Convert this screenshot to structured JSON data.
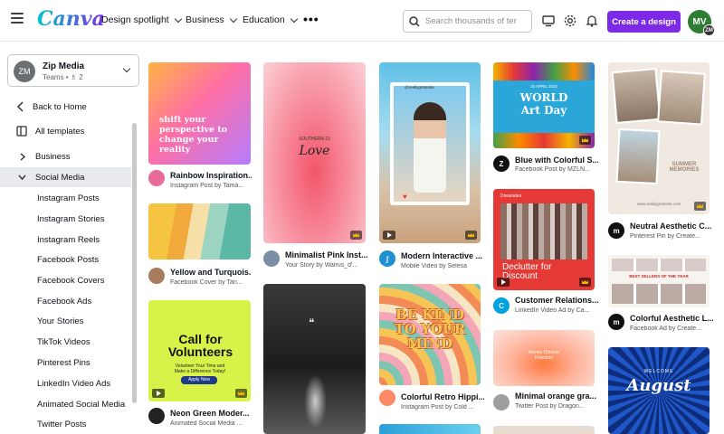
{
  "header": {
    "logo": "Canva",
    "nav": [
      "Design spotlight",
      "Business",
      "Education"
    ],
    "more": "•••",
    "search_placeholder": "Search thousands of ter",
    "create_label": "Create a design",
    "avatar_initials": "MV",
    "avatar_badge": "ZM"
  },
  "team": {
    "initials": "ZM",
    "name": "Zip Media",
    "sub": "Teams • ♗ 2"
  },
  "sidebar": {
    "back": "Back to Home",
    "all": "All templates",
    "business": "Business",
    "social": "Social Media",
    "items": [
      "Instagram Posts",
      "Instagram Stories",
      "Instagram Reels",
      "Facebook Posts",
      "Facebook Covers",
      "Facebook Ads",
      "Your Stories",
      "TikTok Videos",
      "Pinterest Pins",
      "LinkedIn Video Ads",
      "Animated Social Media",
      "Twitter Posts"
    ]
  },
  "cards": {
    "c1": {
      "title": "Rainbow Inspiration...",
      "sub": "Instagram Post by Tama...",
      "text": "shift your perspective to change your reality"
    },
    "c2": {
      "title": "Yellow and Turquois...",
      "sub": "Facebook Cover by Tan..."
    },
    "c3": {
      "title": "Neon Green Moder...",
      "sub": "Animated Social Media ...",
      "text": "Call for Volunteers",
      "small": "Volunteer Your Time and Make a Difference Today!",
      "btn": "Apply Now"
    },
    "c4": {
      "title": "Minimalist Pink Inst...",
      "sub": "Your Story by Walrus_d'...",
      "text": "Love",
      "small": "SOUTHERN 22"
    },
    "c5": {
      "title": "Modern Interactive ...",
      "sub": "Mobile Video by Selesa",
      "handle": "@reallygreatsite"
    },
    "c6": {
      "title": "Blue with Colorful S...",
      "sub": "Facebook Post by MZLN...",
      "text": "WORLD Art Day",
      "date": "15 APRIL 2022"
    },
    "c7": {
      "title": "Declutter for Discount",
      "card_title": "Declutter for Discount",
      "sub": "LinkedIn Video Ad by Ca...",
      "title2": "Customer Relations...",
      "brand": "Dreamden"
    },
    "c8": {
      "title": "Colorful Retro Hippi...",
      "sub": "Instagram Post by Cold ...",
      "text": "BE KIND TO YOUR MIND"
    },
    "c9": {
      "title": "Minimal orange gra...",
      "sub": "Twitter Post by Dragon...",
      "text": "Money Choose Freedom"
    },
    "c10": {
      "title": "Neutral Aesthetic C...",
      "sub": "Pinterest Pin by Create...",
      "text": "SUMMER MEMORIES",
      "url": "www.reallygreatsite.com"
    },
    "c11": {
      "title": "Colorful Aesthetic L...",
      "sub": "Facebook Ad by Create...",
      "text": "BEST SELLERS OF THE YEAR"
    },
    "c12": {
      "text": "August",
      "small": "WELCOME"
    }
  }
}
